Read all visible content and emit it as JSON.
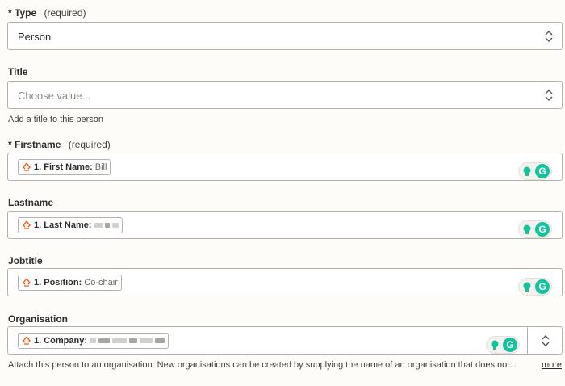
{
  "type_field": {
    "label": "Type",
    "required_mark": "*",
    "required_text": "(required)",
    "value": "Person"
  },
  "title_field": {
    "label": "Title",
    "placeholder": "Choose value...",
    "helper": "Add a title to this person"
  },
  "firstname_field": {
    "label": "Firstname",
    "required_mark": "*",
    "required_text": "(required)",
    "pill": {
      "step": "1. First Name:",
      "value": "Bill"
    }
  },
  "lastname_field": {
    "label": "Lastname",
    "pill": {
      "step": "1. Last Name:",
      "value": ""
    }
  },
  "jobtitle_field": {
    "label": "Jobtitle",
    "pill": {
      "step": "1. Position:",
      "value": "Co-chair"
    }
  },
  "organisation_field": {
    "label": "Organisation",
    "pill": {
      "step": "1. Company:",
      "value": ""
    },
    "helper": "Attach this person to an organisation. New organisations can be created by supplying the name of an organisation that does not...",
    "more_link": "more"
  },
  "colors": {
    "accent_zap": "#ff4f00",
    "grammarly": "#15c39a",
    "border": "#b5b2aa"
  },
  "icons": {
    "zap": "zap-step-icon",
    "grammarly": "grammarly-icon",
    "bulb": "lightbulb-icon",
    "chevron": "chevron-updown-icon"
  }
}
